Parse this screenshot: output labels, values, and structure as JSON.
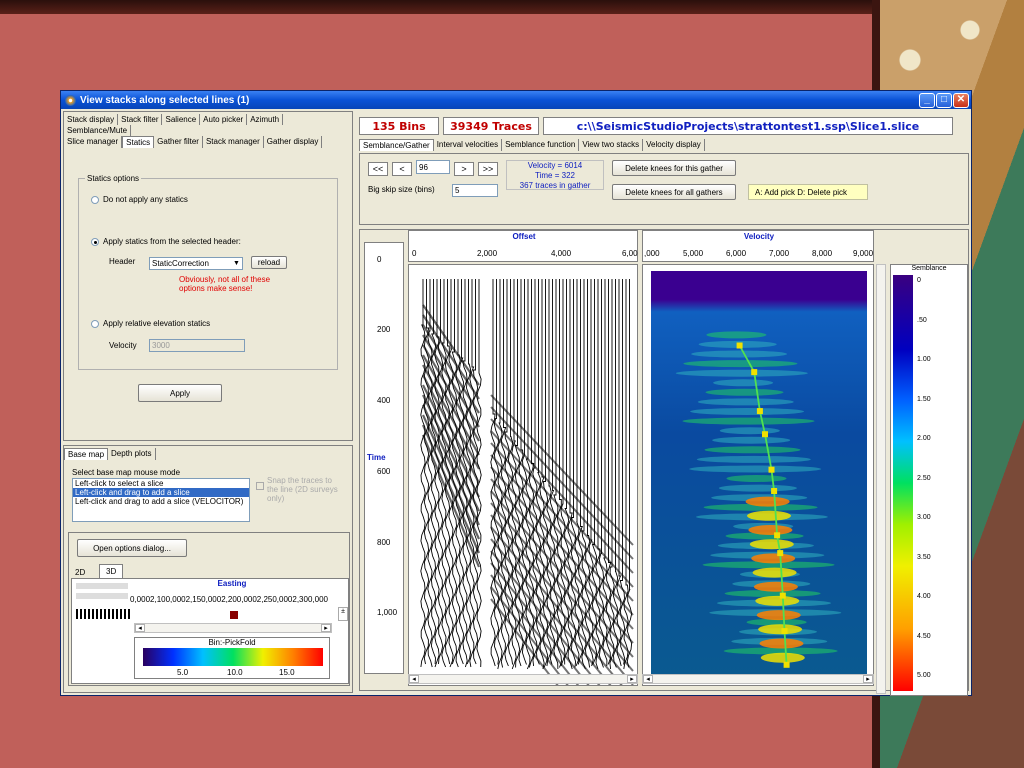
{
  "window": {
    "title": "View stacks along selected lines    (1)",
    "min": "_",
    "max": "□",
    "close": "✕"
  },
  "left_tabs_row1": [
    "Stack display",
    "Stack filter",
    "Salience",
    "Auto picker",
    "Azimuth"
  ],
  "left_tabs_row2": [
    "Semblance/Mute"
  ],
  "left_tabs_row3": [
    "Slice manager",
    "Statics",
    "Gather filter",
    "Stack manager",
    "Gather display"
  ],
  "statics": {
    "group_title": "Statics options",
    "opt_none": "Do not apply any statics",
    "opt_header": "Apply statics from the selected header:",
    "header_label": "Header",
    "header_value": "StaticCorrection",
    "reload": "reload",
    "warning": "Obviously, not all of these options make sense!",
    "opt_elev": "Apply relative elevation statics",
    "velocity_label": "Velocity",
    "velocity_value": "3000",
    "apply": "Apply"
  },
  "lower_tabs": [
    "Base map",
    "Depth plots"
  ],
  "basemap": {
    "mode_label": "Select base map mouse mode",
    "modes": [
      "Left-click to select a slice",
      "Left-click and drag to add a slice",
      "Left-click and drag to add a slice (VELOCITOR)"
    ],
    "snap_label": "Snap the traces to the line (2D surveys only)",
    "open_options": "Open options dialog...",
    "dim_tabs": [
      "2D",
      "3D"
    ],
    "easting_title": "Easting",
    "easting_ticks": "0,0002,100,0002,150,0002,200,0002,250,0002,300,000",
    "legend_title": "Bin:-PickFold",
    "legend_ticks": [
      "5.0",
      "10.0",
      "15.0"
    ]
  },
  "info": {
    "bins": "135 Bins",
    "traces": "39349 Traces",
    "path": "c:\\\\SeismicStudioProjects\\strattontest1.ssp\\Slice1.slice"
  },
  "main_tabs": [
    "Semblance/Gather",
    "Interval velocities",
    "Semblance function",
    "View two stacks",
    "Velocity display"
  ],
  "controls": {
    "first": "<<",
    "prev": "<",
    "bin_value": "96",
    "next": ">",
    "last": ">>",
    "velocity": "Velocity = 6014",
    "time": "Time = 322",
    "traces": "367  traces in gather",
    "delete_this": "Delete knees for this gather",
    "delete_all": "Delete knees for all gathers",
    "skip_label": "Big skip size (bins)",
    "skip_value": "5",
    "hint": "A: Add pick   D: Delete pick"
  },
  "gather": {
    "axis_title": "Offset",
    "ticks": [
      "0",
      "2,000",
      "4,000",
      "6,00"
    ]
  },
  "semblance": {
    "axis_title": "Velocity",
    "ticks": [
      ",000",
      "5,000",
      "6,000",
      "7,000",
      "8,000",
      "9,000"
    ],
    "picks": [
      {
        "velocity": 6050,
        "time": 210
      },
      {
        "velocity": 6390,
        "time": 285
      },
      {
        "velocity": 6520,
        "time": 395
      },
      {
        "velocity": 6640,
        "time": 460
      },
      {
        "velocity": 6790,
        "time": 560
      },
      {
        "velocity": 6850,
        "time": 620
      },
      {
        "velocity": 6920,
        "time": 745
      },
      {
        "velocity": 6990,
        "time": 795
      },
      {
        "velocity": 7050,
        "time": 915
      },
      {
        "velocity": 7090,
        "time": 1015
      },
      {
        "velocity": 7140,
        "time": 1110
      }
    ]
  },
  "time_axis": {
    "title": "Time",
    "ticks": [
      "0",
      "200",
      "400",
      "600",
      "800",
      "1,000"
    ]
  },
  "colorbar": {
    "title": "Semblance",
    "ticks": [
      "0",
      ".50",
      "1.00",
      "1.50",
      "2.00",
      "2.50",
      "3.00",
      "3.50",
      "4.00",
      "4.50",
      "5.00"
    ]
  },
  "colors": {
    "title_blue": "#0a52d6",
    "accent_red": "#c00000",
    "path_blue": "#1020c0",
    "pick_line": "#50e050",
    "pick_point": "#f0e000"
  }
}
